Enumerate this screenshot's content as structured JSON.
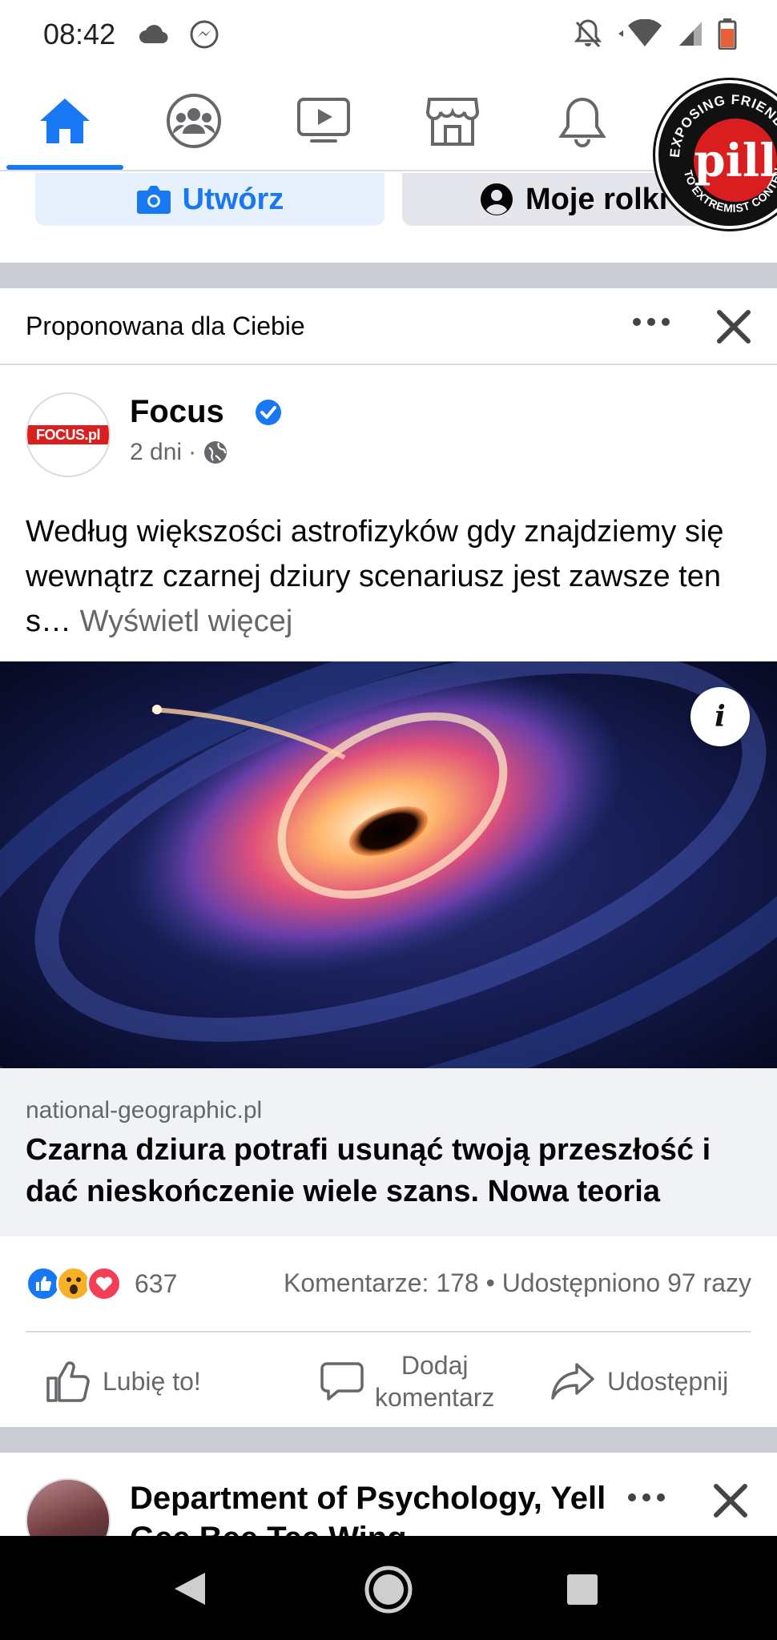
{
  "status_bar": {
    "time": "08:42"
  },
  "nav": {
    "items": [
      {
        "name": "home",
        "active": true
      },
      {
        "name": "groups"
      },
      {
        "name": "video"
      },
      {
        "name": "marketplace"
      },
      {
        "name": "notifications"
      }
    ]
  },
  "sticker": {
    "top_text": "EXPOSING FRIENDS",
    "center_text": "pill",
    "bottom_text": "TO EXTREMIST CONTENT"
  },
  "create_row": {
    "create_label": "Utwórz",
    "reels_label": "Moje rolki"
  },
  "post": {
    "suggested_label": "Proponowana dla Ciebie",
    "author": "Focus",
    "avatar_text": "FOCUS.pl",
    "time": "2 dni",
    "text": "Według większości astrofizyków gdy znajdziemy się wewnątrz czarnej dziury scenariusz jest zawsze ten s… ",
    "see_more": "Wyświetl więcej",
    "link": {
      "domain": "national-geographic.pl",
      "title": "Czarna dziura potrafi usunąć twoją przeszłość i dać nieskończenie wiele szans. Nowa teoria"
    },
    "reactions": {
      "count": "637",
      "comments": "Komentarze: 178",
      "separator": "•",
      "shares": "Udostępniono 97 razy"
    },
    "actions": {
      "like": "Lubię to!",
      "comment_line1": "Dodaj",
      "comment_line2": "komentarz",
      "share": "Udostępnij"
    }
  },
  "next_post": {
    "title": "Department of Psychology, Yell Gee Bee Tee Wing"
  },
  "colors": {
    "accent": "#1877f2",
    "muted": "#65676b",
    "divider": "#c9ccd1"
  }
}
